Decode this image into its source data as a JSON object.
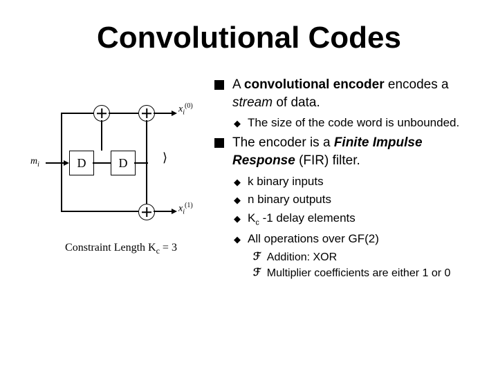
{
  "title": "Convolutional Codes",
  "diagram": {
    "input_label": "m",
    "input_sub": "i",
    "d1": "D",
    "d2": "D",
    "out0_label": "x",
    "out0_sub": "i",
    "out0_sup": "(0)",
    "out1_label": "x",
    "out1_sub": "i",
    "out1_sup": "(1)",
    "constraint_prefix": "Constraint Length K",
    "constraint_sub": "c",
    "constraint_suffix": " = 3"
  },
  "bullets": {
    "p1_pre": "A ",
    "p1_bold": "convolutional encoder",
    "p1_post": " encodes a ",
    "p1_ital": "stream",
    "p1_end": " of data.",
    "p1a": "The size of the code word is unbounded.",
    "p2_pre": "The encoder is a ",
    "p2_bold": "Finite Impulse Response",
    "p2_post": " (FIR) filter.",
    "p2a": "k binary inputs",
    "p2b": "n binary outputs",
    "p2c_pre": "K",
    "p2c_sub": "c",
    "p2c_post": " -1 delay elements",
    "p2d": "All operations over GF(2)",
    "p2d1": "Addition: XOR",
    "p2d2": "Multiplier coefficients are either 1 or 0"
  }
}
